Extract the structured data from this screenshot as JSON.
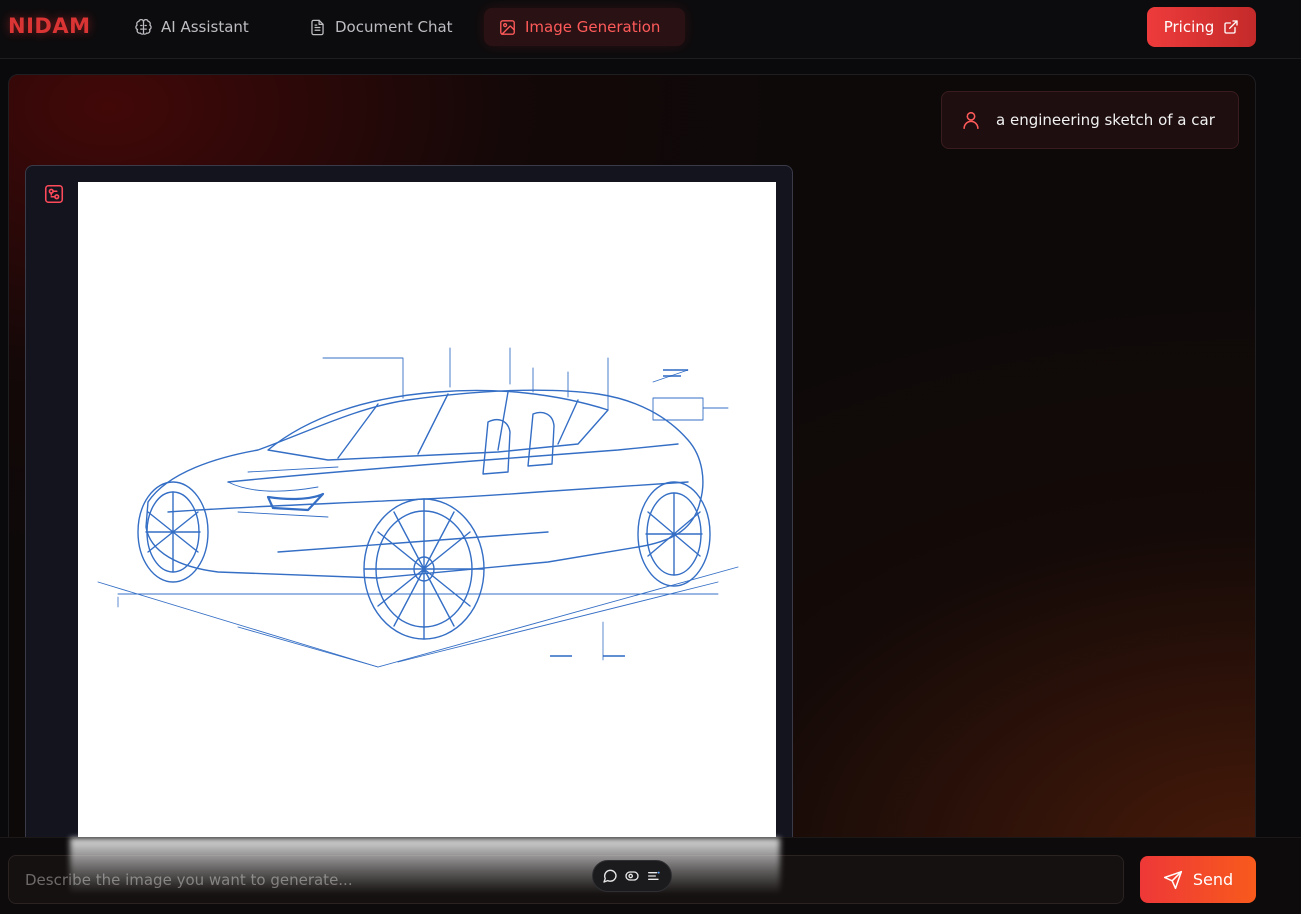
{
  "app": {
    "logo_text": "NIDAM"
  },
  "nav": {
    "items": [
      {
        "label": "AI Assistant",
        "icon": "brain-icon"
      },
      {
        "label": "Document Chat",
        "icon": "document-icon"
      },
      {
        "label": "Image Generation",
        "icon": "image-icon",
        "active": true
      }
    ],
    "pricing_label": "Pricing"
  },
  "chat": {
    "user_message": "a engineering sketch of a car",
    "user_icon": "user-icon",
    "ai_icon": "image-generation-icon",
    "generated_image": "engineering blueprint sketch of a car"
  },
  "composer": {
    "placeholder": "Describe the image you want to generate...",
    "value": "",
    "send_label": "Send",
    "toolbar_icons": [
      "chat-bubble-icon",
      "eye-icon",
      "list-settings-icon"
    ]
  },
  "colors": {
    "accent": "#ee3b3b",
    "accent_orange": "#f85a1c",
    "active_nav_text": "#ff5a5a",
    "background": "#0a0a0c",
    "blueprint_ink": "#1f5fbf"
  }
}
